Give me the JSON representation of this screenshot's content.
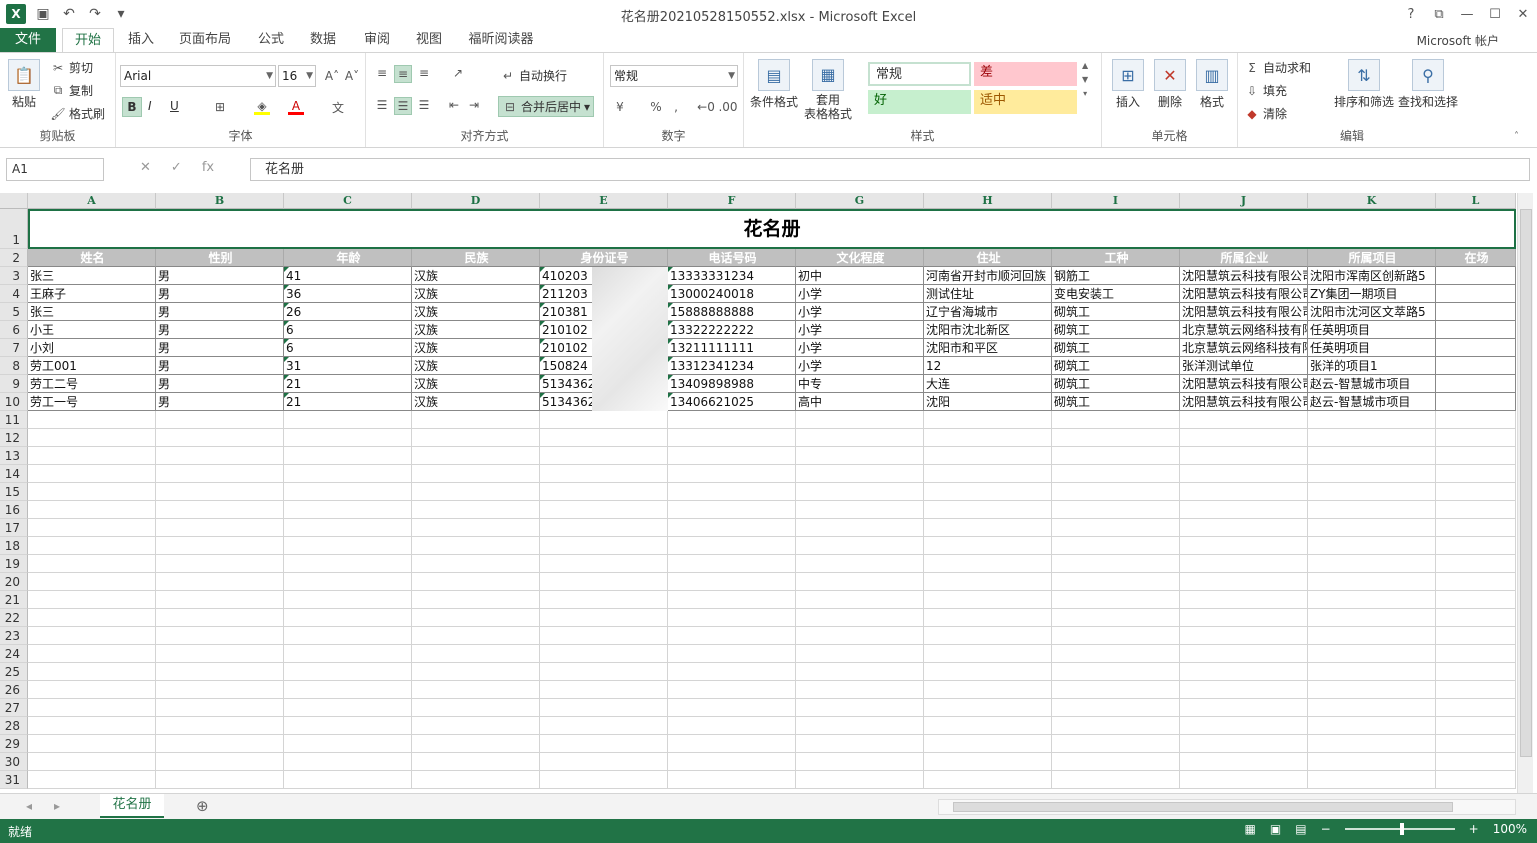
{
  "window": {
    "title": "花名册20210528150552.xlsx - Microsoft Excel",
    "account": "Microsoft 帐户"
  },
  "tabs": [
    {
      "label": "文件"
    },
    {
      "label": "开始"
    },
    {
      "label": "插入"
    },
    {
      "label": "页面布局"
    },
    {
      "label": "公式"
    },
    {
      "label": "数据"
    },
    {
      "label": "审阅"
    },
    {
      "label": "视图"
    },
    {
      "label": "福昕阅读器"
    }
  ],
  "ribbon": {
    "clipboard": {
      "paste": "粘贴",
      "cut": "剪切",
      "copy": "复制",
      "format_painter": "格式刷",
      "label": "剪贴板"
    },
    "font": {
      "name": "Arial",
      "size": "16",
      "label": "字体"
    },
    "alignment": {
      "wrap": "自动换行",
      "merge": "合并后居中",
      "label": "对齐方式"
    },
    "number": {
      "format": "常规",
      "label": "数字"
    },
    "styles": {
      "conditional": "条件格式",
      "table": "套用\n表格格式",
      "normal": "常规",
      "bad": "差",
      "good": "好",
      "neutral": "适中",
      "label": "样式"
    },
    "cells": {
      "insert": "插入",
      "delete": "删除",
      "format": "格式",
      "label": "单元格"
    },
    "editing": {
      "autosum": "自动求和",
      "fill": "填充",
      "clear": "清除",
      "sort": "排序和筛选",
      "find": "查找和选择",
      "label": "编辑"
    }
  },
  "formula_bar": {
    "name_box": "A1",
    "fx": "fx",
    "value": "花名册"
  },
  "sheet": {
    "columns": [
      "A",
      "B",
      "C",
      "D",
      "E",
      "F",
      "G",
      "H",
      "I",
      "J",
      "K",
      "L"
    ],
    "title": "花名册",
    "headers": [
      "姓名",
      "性别",
      "年龄",
      "民族",
      "身份证号",
      "电话号码",
      "文化程度",
      "住址",
      "工种",
      "所属企业",
      "所属项目",
      "在场"
    ],
    "rows": [
      [
        "张三",
        "男",
        "41",
        "汉族",
        "410203",
        "13333331234",
        "初中",
        "河南省开封市顺河回族",
        "钢筋工",
        "沈阳慧筑云科技有限公司",
        "沈阳市浑南区创新路5",
        ""
      ],
      [
        "王麻子",
        "男",
        "36",
        "汉族",
        "211203",
        "13000240018",
        "小学",
        "测试住址",
        "变电安装工",
        "沈阳慧筑云科技有限公司",
        "ZY集团一期项目",
        ""
      ],
      [
        "张三",
        "男",
        "26",
        "汉族",
        "210381",
        "15888888888",
        "小学",
        "辽宁省海城市",
        "砌筑工",
        "沈阳慧筑云科技有限公司",
        "沈阳市沈河区文萃路5",
        ""
      ],
      [
        "小王",
        "男",
        "6",
        "汉族",
        "210102",
        "13322222222",
        "小学",
        "沈阳市沈北新区",
        "砌筑工",
        "北京慧筑云网络科技有限",
        "任英明项目",
        ""
      ],
      [
        "小刘",
        "男",
        "6",
        "汉族",
        "210102",
        "13211111111",
        "小学",
        "沈阳市和平区",
        "砌筑工",
        "北京慧筑云网络科技有限",
        "任英明项目",
        ""
      ],
      [
        "劳工001",
        "男",
        "31",
        "汉族",
        "150824",
        "13312341234",
        "小学",
        "12",
        "砌筑工",
        "张洋测试单位",
        "张洋的项目1",
        ""
      ],
      [
        "劳工二号",
        "男",
        "21",
        "汉族",
        "5134362",
        "13409898988",
        "中专",
        "大连",
        "砌筑工",
        "沈阳慧筑云科技有限公司",
        "赵云-智慧城市项目",
        ""
      ],
      [
        "劳工一号",
        "男",
        "21",
        "汉族",
        "5134362",
        "13406621025",
        "高中",
        "沈阳",
        "砌筑工",
        "沈阳慧筑云科技有限公司",
        "赵云-智慧城市项目",
        ""
      ]
    ],
    "row_numbers": [
      "1",
      "2",
      "3",
      "4",
      "5",
      "6",
      "7",
      "8",
      "9",
      "10",
      "11",
      "12",
      "13",
      "14",
      "15",
      "16",
      "17",
      "18",
      "19",
      "20",
      "21",
      "22",
      "23",
      "24",
      "25",
      "26",
      "27",
      "28",
      "29",
      "30",
      "31"
    ]
  },
  "sheet_tabs": [
    {
      "label": "花名册"
    }
  ],
  "status": {
    "ready": "就绪",
    "zoom": "100%"
  }
}
